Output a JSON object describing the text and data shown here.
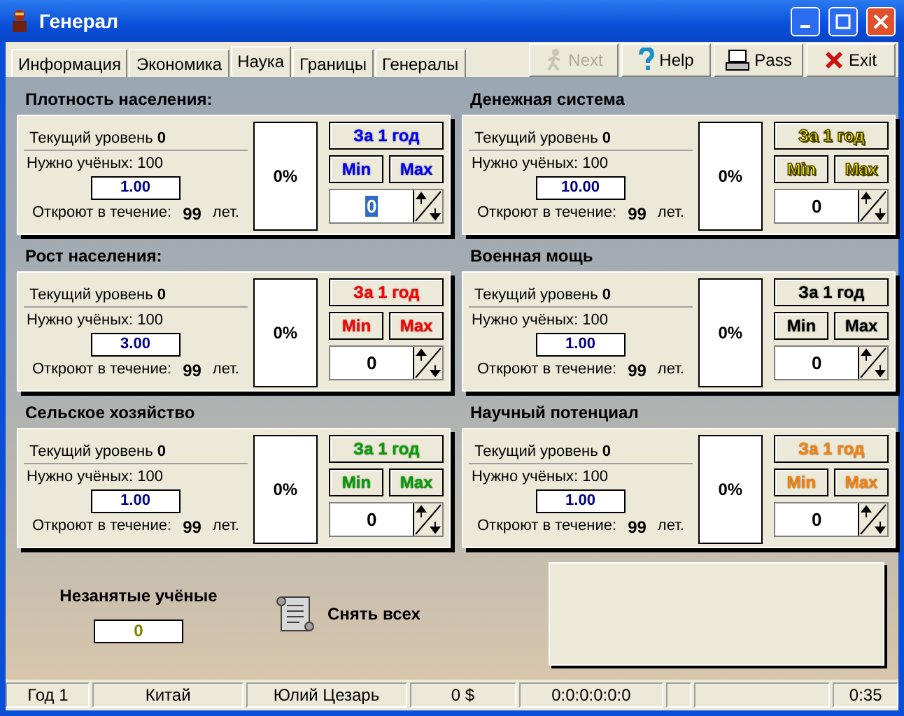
{
  "window": {
    "title": "Генерал"
  },
  "tabs": [
    {
      "label": "Информация",
      "selected": false
    },
    {
      "label": "Экономика",
      "selected": false
    },
    {
      "label": "Наука",
      "selected": true
    },
    {
      "label": "Границы",
      "selected": false
    },
    {
      "label": "Генералы",
      "selected": false
    }
  ],
  "toolbar": [
    {
      "kind": "next",
      "label": "Next",
      "disabled": true
    },
    {
      "kind": "help",
      "label": "Help",
      "disabled": false
    },
    {
      "kind": "pass",
      "label": "Pass",
      "disabled": false
    },
    {
      "kind": "exit",
      "label": "Exit",
      "disabled": false
    }
  ],
  "panels": [
    {
      "title": "Плотность населения:",
      "current_label": "Текущий уровень",
      "current_value": "0",
      "needed": "Нужно учёных: 100",
      "rate": "1.00",
      "opens_label": "Откроют в течение:",
      "years": "99",
      "years_unit": "лет.",
      "percent": "0%",
      "year_button": "За 1 год",
      "min_button": "Min",
      "max_button": "Max",
      "count": "0",
      "focused": true,
      "color": "#0000ff"
    },
    {
      "title": "Денежная система",
      "current_label": "Текущий уровень",
      "current_value": "0",
      "needed": "Нужно учёных: 100",
      "rate": "10.00",
      "opens_label": "Откроют в течение:",
      "years": "99",
      "years_unit": "лет.",
      "percent": "0%",
      "year_button": "За 1 год",
      "min_button": "Min",
      "max_button": "Max",
      "count": "0",
      "focused": false,
      "color": "#ffff00"
    },
    {
      "title": "Рост населения:",
      "current_label": "Текущий уровень",
      "current_value": "0",
      "needed": "Нужно учёных: 100",
      "rate": "3.00",
      "opens_label": "Откроют в течение:",
      "years": "99",
      "years_unit": "лет.",
      "percent": "0%",
      "year_button": "За 1 год",
      "min_button": "Min",
      "max_button": "Max",
      "count": "0",
      "focused": false,
      "color": "#ff0000"
    },
    {
      "title": "Военная мощь",
      "current_label": "Текущий уровень",
      "current_value": "0",
      "needed": "Нужно учёных: 100",
      "rate": "1.00",
      "opens_label": "Откроют в течение:",
      "years": "99",
      "years_unit": "лет.",
      "percent": "0%",
      "year_button": "За 1 год",
      "min_button": "Min",
      "max_button": "Max",
      "count": "0",
      "focused": false,
      "color": "#000000"
    },
    {
      "title": "Сельское хозяйство",
      "current_label": "Текущий уровень",
      "current_value": "0",
      "needed": "Нужно учёных: 100",
      "rate": "1.00",
      "opens_label": "Откроют в течение:",
      "years": "99",
      "years_unit": "лет.",
      "percent": "0%",
      "year_button": "За 1 год",
      "min_button": "Min",
      "max_button": "Max",
      "count": "0",
      "focused": false,
      "color": "#00a000"
    },
    {
      "title": "Научный потенциал",
      "current_label": "Текущий уровень",
      "current_value": "0",
      "needed": "Нужно учёных: 100",
      "rate": "1.00",
      "opens_label": "Откроют в течение:",
      "years": "99",
      "years_unit": "лет.",
      "percent": "0%",
      "year_button": "За 1 год",
      "min_button": "Min",
      "max_button": "Max",
      "count": "0",
      "focused": false,
      "color": "#ff8000"
    }
  ],
  "idle": {
    "label": "Незанятые учёные",
    "value": "0"
  },
  "remove_all": {
    "label": "Снять всех"
  },
  "status_bar": [
    "Год 1",
    "Китай",
    "Юлий Цезарь",
    "0 $",
    "0:0:0:0:0:0",
    "0:35"
  ]
}
